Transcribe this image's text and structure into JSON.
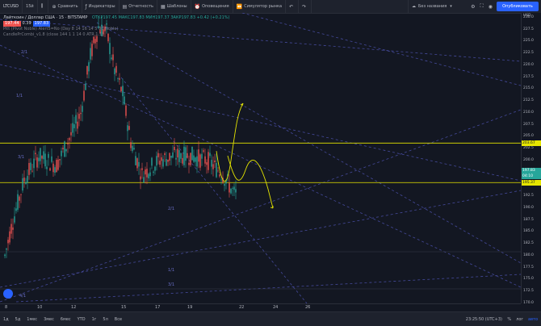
{
  "toolbar": {
    "symbol": "LTCUSD",
    "interval": "15й",
    "compare": "Сравнить",
    "indicators": "Индикаторы",
    "financials": "Отчетность",
    "templates": "Шаблоны",
    "alerts": "Оповещения",
    "replay": "Симулятор рынка",
    "layout_name": "Без названия",
    "publish": "Опубликовать"
  },
  "legend": {
    "title": "Лайткоин / Доллар США · 15 · BITSTAMP",
    "ohlc": "ОТКР197.45 МАКС197.83 МИН197.37 ЗАКР197.83 +0.42 (+0.21%)",
    "bid": "197.44",
    "spread": "0.39",
    "ask": "197.83",
    "indicator1": "Pitt (Pivot Noble) Alert5=No (Day 8 14 16 14 5 30 Noble)",
    "indicator2": "CandlePrCombi_v1.8 (close 144 1 1 14 0 ATR 1.1)"
  },
  "price_axis": {
    "ticks": [
      "230.0",
      "227.5",
      "225.0",
      "222.5",
      "220.0",
      "217.5",
      "215.0",
      "212.5",
      "210.0",
      "207.5",
      "205.0",
      "202.5",
      "200.0",
      "197.5",
      "195.0",
      "192.5",
      "190.0",
      "187.5",
      "185.0",
      "182.5",
      "180.0",
      "177.5",
      "175.0",
      "172.5",
      "170.0"
    ],
    "top_label": "USD",
    "level_high": "203.67",
    "current_price": "197.83",
    "countdown": "04:10",
    "level_low": "195.37"
  },
  "time_axis": {
    "ticks": [
      "8",
      "10",
      "12",
      "15",
      "17",
      "19",
      "22",
      "24",
      "26"
    ]
  },
  "chart_labels": {
    "fib_labels": [
      "2/1",
      "1/1",
      "3/1",
      "2/1",
      "1/1",
      "3/1",
      "4/1"
    ]
  },
  "bottombar": {
    "ranges": [
      "1д",
      "5д",
      "1мес",
      "3мес",
      "6мес",
      "YTD",
      "1г",
      "5л",
      "Все"
    ],
    "clock": "23:25:50 (UTC+3)",
    "pct": "%",
    "log": "лог",
    "auto": "авто"
  },
  "colors": {
    "up": "#26a69a",
    "down": "#ef5350",
    "level": "#e6e600",
    "fan": "#4a4fa8",
    "projection": "#e6e600",
    "accent": "#2962ff"
  },
  "chart_data": {
    "type": "candlestick",
    "y_range": [
      170.0,
      231.0
    ],
    "x_ticks": [
      "8",
      "10",
      "12",
      "15",
      "17",
      "19",
      "22",
      "24",
      "26"
    ],
    "horizontal_levels": [
      203.67,
      195.37
    ],
    "current_price": 197.83
  }
}
